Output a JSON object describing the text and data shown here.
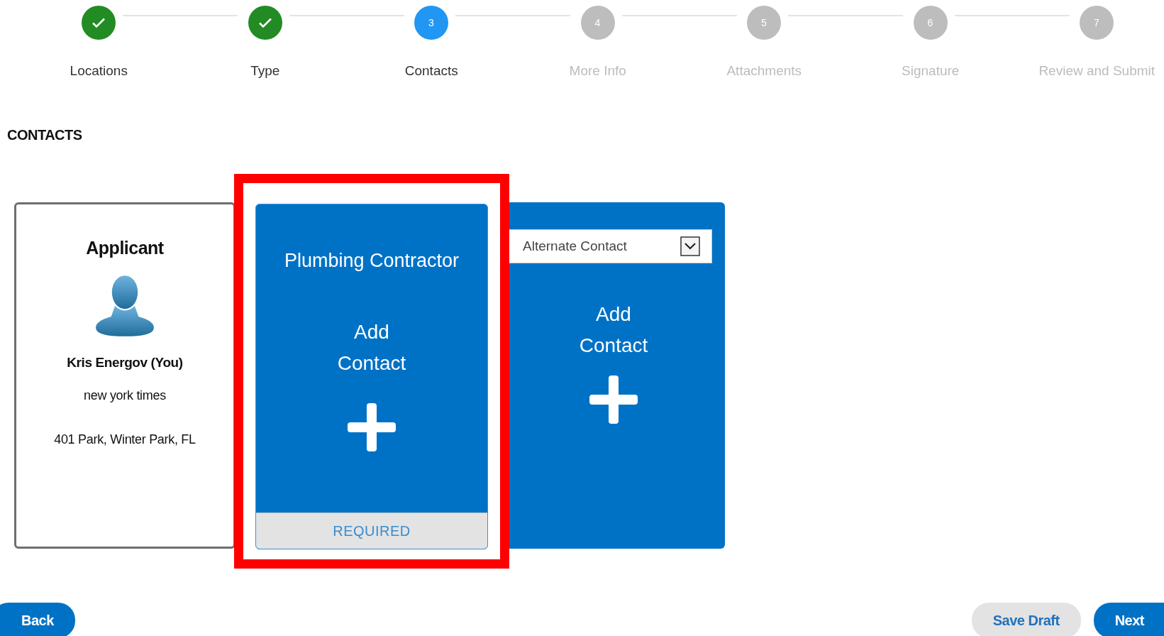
{
  "stepper": {
    "steps": [
      {
        "label": "Locations",
        "completed": true,
        "selected": false
      },
      {
        "label": "Type",
        "completed": true,
        "selected": false
      },
      {
        "label": "Contacts",
        "number": "3",
        "completed": false,
        "selected": true
      },
      {
        "label": "More Info",
        "number": "4",
        "completed": false,
        "selected": false
      },
      {
        "label": "Attachments",
        "number": "5",
        "completed": false,
        "selected": false
      },
      {
        "label": "Signature",
        "number": "6",
        "completed": false,
        "selected": false
      },
      {
        "label": "Review and Submit",
        "number": "7",
        "completed": false,
        "selected": false
      }
    ]
  },
  "section_title": "CONTACTS",
  "contact_cards": [
    {
      "kind": "applicant",
      "role": "Applicant",
      "name": "Kris Energov (You)",
      "company": "new york times",
      "address": "401 Park, Winter Park, FL",
      "highlighted": false
    },
    {
      "kind": "add",
      "title": "Plumbing Contractor",
      "action": "Add Contact",
      "footer": "REQUIRED",
      "highlighted": true
    },
    {
      "kind": "add_select",
      "select": {
        "value": "Alternate Contact"
      },
      "action": "Add Contact",
      "highlighted": false
    }
  ],
  "buttons": [
    {
      "label": "Back",
      "kind": "primary"
    },
    {
      "label": "Save Draft",
      "kind": "secondary"
    },
    {
      "label": "Next",
      "kind": "primary"
    }
  ]
}
